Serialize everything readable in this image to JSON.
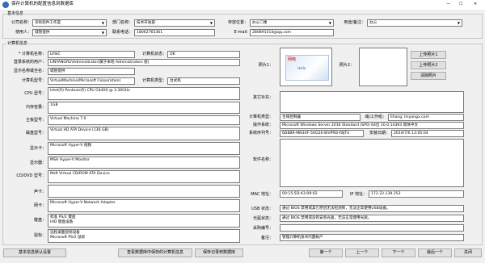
{
  "window": {
    "title": "保存计算机的配置信息到数据库",
    "min": "—",
    "max": "☐",
    "close": "✕"
  },
  "basic": {
    "group": "基本信息",
    "company_label": "公司名称：",
    "company": "深圳软件工作室",
    "dept_label": "部门名称：",
    "dept": "技术开发部",
    "location_label": "存放位置：",
    "location": "办公二楼",
    "purpose_label": "用途/备注：",
    "purpose": "办公",
    "user_label": "使用人：",
    "user": "城管提供",
    "contact_label": "联系电话：",
    "contact": "18062765361",
    "email_label": "E-mail:",
    "email": "280891514@qq.com"
  },
  "comp": {
    "group": "计算机信息",
    "name_label": "* 计算机名称：",
    "name": "LVSIC",
    "status_label": "计算机状态：",
    "status": "OK",
    "login_label": "登录系统的用户：",
    "login": "LINYANGRU\\Administrator(属于本地 Administrators 组)",
    "logon_label": "显示名称或全名：",
    "logon": "城管提供",
    "mfr_label": "计算机型号：",
    "mfr": "VirtualMachine(Microsoft Corporation)",
    "type_label": "计算机类型：",
    "type": "台式机",
    "cpu_label": "CPU 型号：",
    "cpu": "Intel(R) Pentium(R) CPU G4400 @ 3.30GHz",
    "mem_label": "内存容量：",
    "mem": "1GB",
    "board_label": "主板型号：",
    "board": "Virtual Machine 7.0",
    "disk_label": "磁盘型号：",
    "disk": "Virtual HD ATA Device (136 GB)",
    "display_label": "显示卡：",
    "display": "Microsoft Hyper-V 视频",
    "monitor_label": "显示器：",
    "monitor": "MSH Hyper-V Monitor",
    "cdrom_label": "CD/DVD 型号：",
    "cdrom": "Msft Virtual CD/ROM ATA Device",
    "sound_label": "声卡：",
    "sound": "",
    "net_label": "网卡：",
    "net": "Microsoft Hyper-V Network Adapter",
    "kbd_label": "键盘：",
    "kbd": "标准 PS/2 键盘",
    "kbd2": "HID 键盘设备",
    "mouse_label": "鼠标：",
    "mouse": "远程桌面鼠标设备",
    "mouse2": "Microsoft PS/2 鼠标"
  },
  "right": {
    "photo1_label": "照片1：",
    "photo2_label": "照片2：",
    "photo_text": "网络",
    "photo_caption": "Hello",
    "upload1": "上传照片1",
    "upload2": "上传照片2",
    "clear": "清除照片",
    "other_label": "其它补充：",
    "os_label": "计算机类型：",
    "os_type": "主域控制器",
    "domain_label": "域/工作组：",
    "domain": "lihang: linyangx.com",
    "osname_label": "操作系统：",
    "osname": "Microsoft Windows Server 2016 Standard (SP0) 64位 10.0.14393 简体中文",
    "serial_label": "系统序列号：",
    "serial": "6D8BR-MN3XF-5XG26-WVPRD-Y8JT4",
    "installed_label": "安装日期：",
    "installed": "2019/7/6 13:05:04",
    "software_label": "软件名称：",
    "mac_label": "MAC 地址：",
    "mac": "00:15:5D:A3:09:02",
    "ip_label": "IP 地址：",
    "ip": "172.22.139.253",
    "usb_label": "USB 状态：",
    "usb": "通过 BIOS 禁用或其它原因无法检测到，无法正常使用USB设备。",
    "pci_label": "光驱状态：",
    "pci": "通过 BIOS 禁用或没有安装光驱，无法正常使用光驱。",
    "sn_label": "采购编号：",
    "sn": "",
    "remark_label": "备注：",
    "remark": "管理计算机技术内置帐户"
  },
  "footer": {
    "settings": "基本信息默认设置",
    "view": "查看数据库中保存的计算机信息",
    "save": "保存记录到数据库",
    "first": "第一个",
    "prev": "上一个",
    "next": "下一个",
    "last": "最后一个",
    "close": "关闭"
  }
}
